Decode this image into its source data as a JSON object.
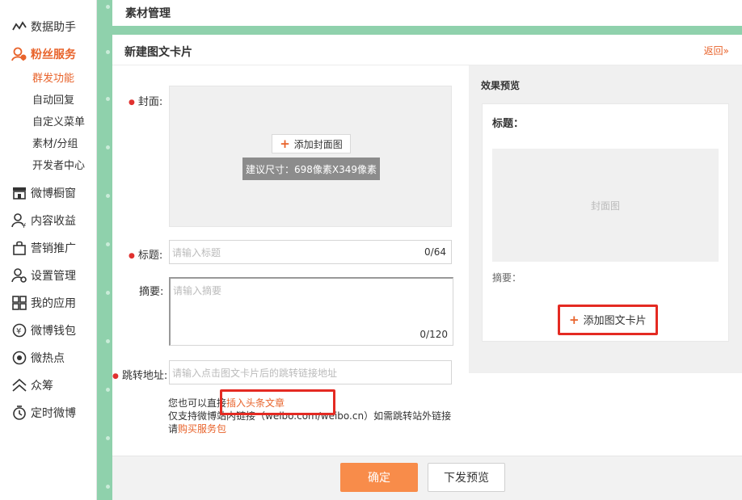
{
  "sidebar": {
    "items": [
      {
        "label": "数据助手",
        "icon": "chart-line-icon"
      },
      {
        "label": "粉丝服务",
        "icon": "fans-icon"
      },
      {
        "label": "微博橱窗",
        "icon": "shop-window-icon"
      },
      {
        "label": "内容收益",
        "icon": "user-yen-icon"
      },
      {
        "label": "营销推广",
        "icon": "bag-icon"
      },
      {
        "label": "设置管理",
        "icon": "user-gear-icon"
      },
      {
        "label": "我的应用",
        "icon": "grid-icon"
      },
      {
        "label": "微博钱包",
        "icon": "wallet-icon"
      },
      {
        "label": "微热点",
        "icon": "eye-icon"
      },
      {
        "label": "众筹",
        "icon": "crowdfund-icon"
      },
      {
        "label": "定时微博",
        "icon": "clock-icon"
      }
    ],
    "sub_items": [
      "群发功能",
      "自动回复",
      "自定义菜单",
      "素材/分组",
      "开发者中心"
    ]
  },
  "top": {
    "title": "素材管理"
  },
  "panel": {
    "title": "新建图文卡片",
    "back": "返回»"
  },
  "form": {
    "cover_label": "封面:",
    "add_cover": "添加封面图",
    "size_tip": "建议尺寸：698像素X349像素",
    "title_label": "标题:",
    "title_placeholder": "请输入标题",
    "title_count": "0/64",
    "summary_label": "摘要:",
    "summary_placeholder": "请输入摘要",
    "summary_count": "0/120",
    "url_label": "跳转地址:",
    "url_placeholder": "请输入点击图文卡片后的跳转链接地址",
    "hint1_prefix": "您也可以直接",
    "hint1_link": "插入头条文章",
    "hint2": "仅支持微博站内链接（weibo.com/weibo.cn）如需跳转站外链接",
    "hint3_prefix": "请",
    "hint3_link": "购买服务包"
  },
  "preview": {
    "title": "效果预览",
    "card_title": "标题：",
    "cover_text": "封面图",
    "summary": "摘要：",
    "add_card": "添加图文卡片"
  },
  "footer": {
    "confirm": "确定",
    "send_preview": "下发预览"
  },
  "colors": {
    "accent": "#e8632b",
    "confirm_button": "#f88c4a",
    "highlight_box": "#e42a22",
    "background_green": "#8fd1ac"
  }
}
